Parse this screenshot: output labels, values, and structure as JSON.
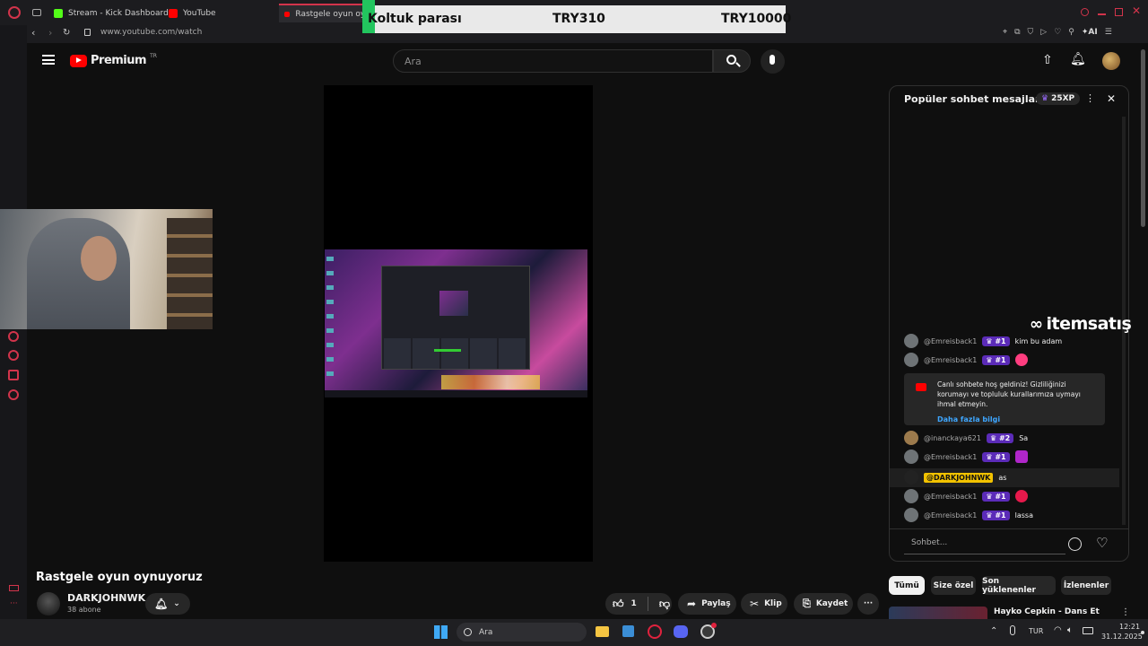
{
  "browser": {
    "tabs": [
      {
        "label": "Stream - Kick Dashboard"
      },
      {
        "label": "YouTube"
      },
      {
        "label": "Rastgele oyun oynu"
      }
    ],
    "url": "www.youtube.com/watch",
    "ai_label": "AI"
  },
  "header": {
    "brand": "Premium",
    "brand_region": "TR",
    "search_placeholder": "Ara"
  },
  "overlay_banner": {
    "label": "Koltuk parası",
    "current": "TRY310",
    "goal": "TRY10000"
  },
  "video": {
    "title": "Rastgele oyun oynuyoruz",
    "channel": "DARKJOHNWK",
    "subscribers": "38 abone",
    "likes": "1",
    "share_label": "Paylaş",
    "clip_label": "Klip",
    "save_label": "Kaydet"
  },
  "chat": {
    "header_title": "Popüler sohbet mesajları",
    "xp": "25XP",
    "watermark": "itemsatış",
    "messages": [
      {
        "author": "@Emreisback1",
        "badge": "#1",
        "text": "kim bu adam",
        "emoji": ""
      },
      {
        "author": "@Emreisback1",
        "badge": "#1",
        "text": "",
        "emoji": "#ff3d7f"
      },
      {
        "author": "@inanckaya621",
        "badge": "#2",
        "text": "Sa",
        "emoji": ""
      },
      {
        "author": "@Emreisback1",
        "badge": "#1",
        "text": "",
        "emoji": "#b026c9"
      },
      {
        "author": "@DARKJOHNWK",
        "badge": "",
        "text": "as",
        "emoji": ""
      },
      {
        "author": "@Emreisback1",
        "badge": "#1",
        "text": "",
        "emoji": "#e6194b"
      },
      {
        "author": "@Emreisback1",
        "badge": "#1",
        "text": "lassa",
        "emoji": ""
      }
    ],
    "welcome_text": "Canlı sohbete hoş geldiniz! Gizliliğinizi korumayı ve topluluk kurallarımıza uymayı ihmal etmeyin.",
    "welcome_link": "Daha fazla bilgi",
    "input_placeholder": "Sohbet..."
  },
  "related": {
    "chips": [
      "Tümü",
      "Size özel",
      "Son yüklenenler",
      "İzlenenler"
    ],
    "first_title": "Hayko Cepkin - Dans Et"
  },
  "taskbar": {
    "search_label": "Ara",
    "lang": "TUR",
    "time": "12:21",
    "date": "31.12.2025"
  },
  "colors": {
    "yt_red": "#ff0000",
    "badge_purple": "#5b2bb8",
    "highlight_yellow": "#f2c200",
    "link_blue": "#3ea6ff",
    "opera_red": "#d2344b"
  }
}
